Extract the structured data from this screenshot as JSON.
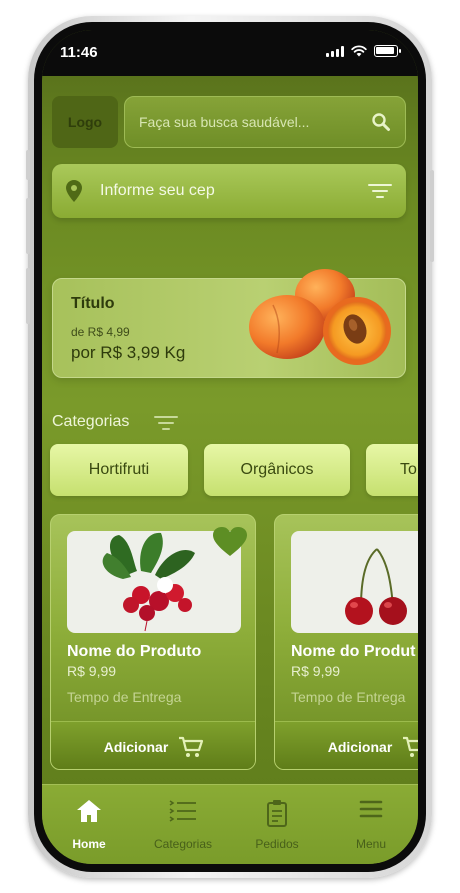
{
  "status": {
    "time": "11:46"
  },
  "header": {
    "logo": "Logo",
    "search_placeholder": "Faça sua busca saudável..."
  },
  "cep": {
    "label": "Informe seu cep"
  },
  "promo": {
    "title": "Título",
    "old_price": "de R$ 4,99",
    "new_price": "por R$ 3,99 Kg"
  },
  "categories": {
    "title": "Categorias",
    "chips": [
      {
        "label": "Hortifruti"
      },
      {
        "label": "Orgânicos"
      },
      {
        "label": "To"
      }
    ]
  },
  "products": [
    {
      "name": "Nome do Produto",
      "price": "R$ 9,99",
      "delivery": "Tempo de Entrega",
      "button": "Adicionar",
      "icon": "radish"
    },
    {
      "name": "Nome do Produt",
      "price": "R$ 9,99",
      "delivery": "Tempo de Entrega",
      "button": "Adicionar",
      "icon": "cherry"
    }
  ],
  "tabs": [
    {
      "label": "Home",
      "icon": "home-icon",
      "active": true
    },
    {
      "label": "Categorias",
      "icon": "list-icon",
      "active": false
    },
    {
      "label": "Pedidos",
      "icon": "clipboard-icon",
      "active": false
    },
    {
      "label": "Menu",
      "icon": "menu-icon",
      "active": false
    }
  ],
  "colors": {
    "accent": "#7a9a2a",
    "chip": "#d8ef8c",
    "text_dark": "#2e3b0c"
  }
}
